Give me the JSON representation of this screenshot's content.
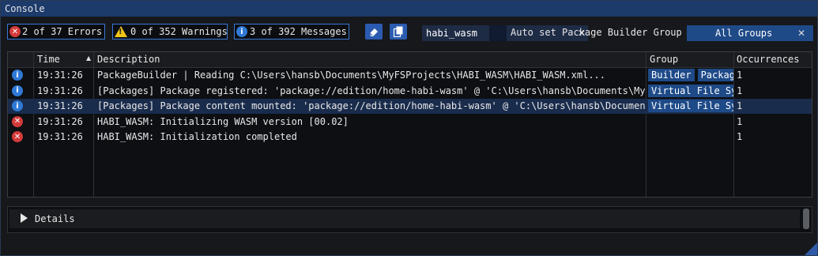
{
  "window": {
    "title": "Console"
  },
  "filters": {
    "errors": "2 of 37 Errors",
    "warnings": "0 of 352 Warnings",
    "messages": "3 of 392 Messages"
  },
  "search": {
    "value": "habi_wasm"
  },
  "autoset_label": "Auto set Package Builder Group",
  "group_filter": {
    "value": "All Groups"
  },
  "table": {
    "headers": {
      "time": "Time",
      "description": "Description",
      "group": "Group",
      "occurrences": "Occurrences"
    },
    "rows": [
      {
        "icon": "info-icon",
        "time": "19:31:26",
        "description": "PackageBuilder | Reading C:\\Users\\hansb\\Documents\\MyFSProjects\\HABI_WASM\\HABI_WASM.xml...",
        "groups": [
          "Builder",
          "Package"
        ],
        "occurrences": "1"
      },
      {
        "icon": "info-icon",
        "time": "19:31:26",
        "description": "[Packages] Package registered: 'package://edition/home-habi-wasm' @ 'C:\\Users\\hansb\\Documents\\MyFSProjects\\HABI_WASM'",
        "groups": [
          "Virtual File System"
        ],
        "occurrences": "1"
      },
      {
        "icon": "info-icon",
        "time": "19:31:26",
        "description": "[Packages] Package content mounted: 'package://edition/home-habi-wasm' @ 'C:\\Users\\hansb\\Documents\\MyFSProjects'",
        "groups": [
          "Virtual File System"
        ],
        "occurrences": "1"
      },
      {
        "icon": "error-icon",
        "time": "19:31:26",
        "description": "HABI_WASM: Initializing WASM version [00.02]",
        "groups": [],
        "occurrences": "1"
      },
      {
        "icon": "error-icon",
        "time": "19:31:26",
        "description": "HABI_WASM: Initialization completed",
        "groups": [],
        "occurrences": "1"
      }
    ]
  },
  "details": {
    "label": "Details"
  },
  "colors": {
    "accent": "#3b78d8",
    "titlebar": "#1c3a6a",
    "error": "#d33a3a",
    "info": "#2f79d6",
    "warning": "#f0c419",
    "selected_row": "#1a2c4c"
  }
}
